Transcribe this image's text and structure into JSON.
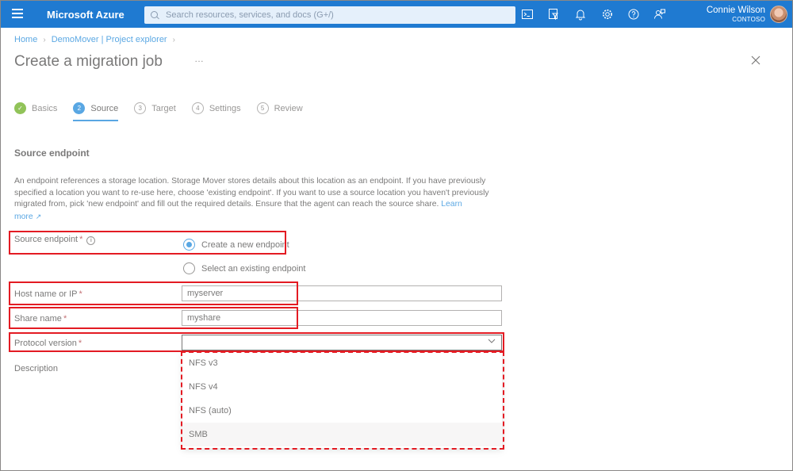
{
  "topbar": {
    "brand": "Microsoft Azure",
    "search_placeholder": "Search resources, services, and docs (G+/)",
    "user_name": "Connie Wilson",
    "user_org": "CONTOSO",
    "icons": [
      "cloud-shell-icon",
      "directory-filter-icon",
      "notifications-icon",
      "settings-icon",
      "help-icon",
      "feedback-icon"
    ]
  },
  "breadcrumb": {
    "items": [
      "Home",
      "DemoMover | Project explorer"
    ]
  },
  "page": {
    "title": "Create a migration job"
  },
  "tabs": [
    {
      "num": "✓",
      "label": "Basics",
      "state": "done"
    },
    {
      "num": "2",
      "label": "Source",
      "state": "active"
    },
    {
      "num": "3",
      "label": "Target",
      "state": "pending"
    },
    {
      "num": "4",
      "label": "Settings",
      "state": "pending"
    },
    {
      "num": "5",
      "label": "Review",
      "state": "pending"
    }
  ],
  "section": {
    "title": "Source endpoint",
    "description": "An endpoint references a storage location. Storage Mover stores details about this location as an endpoint. If you have previously specified a location you want to re-use here, choose 'existing endpoint'. If you want to use a source location you haven't previously migrated from, pick 'new endpoint' and fill out the required details. Ensure that the agent can reach the source share.",
    "learn_more": "Learn more"
  },
  "form": {
    "source_endpoint_label": "Source endpoint",
    "radio_new": "Create a new endpoint",
    "radio_existing": "Select an existing endpoint",
    "host_label": "Host name or IP",
    "host_value": "myserver",
    "share_label": "Share name",
    "share_value": "myshare",
    "protocol_label": "Protocol version",
    "protocol_value": "",
    "description_label": "Description",
    "required_mark": "*"
  },
  "dropdown": {
    "options": [
      "NFS v3",
      "NFS v4",
      "NFS (auto)",
      "SMB"
    ],
    "highlighted": "SMB"
  },
  "colors": {
    "accent": "#0078d4",
    "topbar": "#1f7ad1",
    "highlight_box": "#e31b23",
    "done_step": "#57a300"
  }
}
